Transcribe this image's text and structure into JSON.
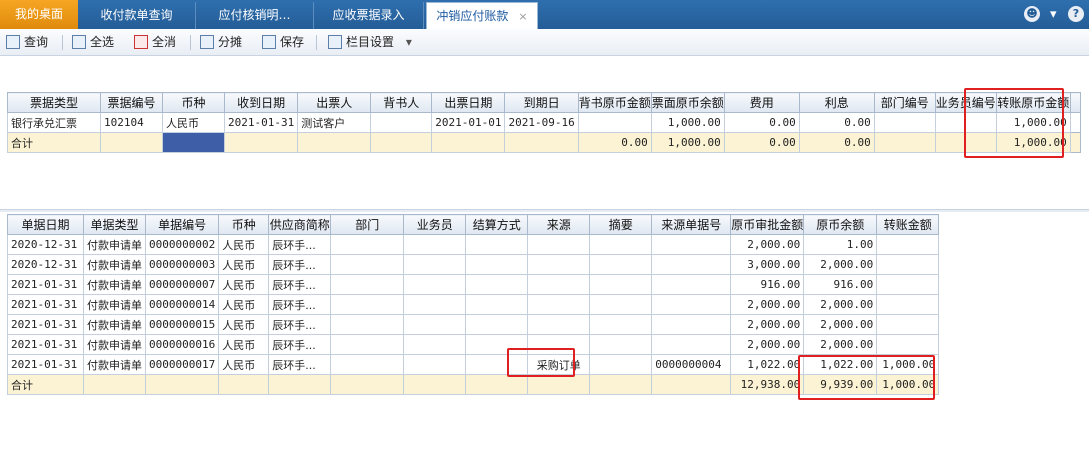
{
  "tabs": [
    {
      "label": "我的桌面"
    },
    {
      "label": "收付款单查询"
    },
    {
      "label": "应付核销明…"
    },
    {
      "label": "应收票据录入"
    },
    {
      "label": "冲销应付账款"
    }
  ],
  "tab_close": "×",
  "window_icons": {
    "user": "☻",
    "dropdown": "▾",
    "help": "?"
  },
  "toolbar": {
    "query": "查询",
    "select_all": "全选",
    "deselect_all": "全消",
    "split": "分摊",
    "save": "保存",
    "columns": "栏目设置",
    "columns_arrow": "▾"
  },
  "upper_table": {
    "headers": [
      "票据类型",
      "票据编号",
      "币种",
      "收到日期",
      "出票人",
      "背书人",
      "出票日期",
      "到期日",
      "背书原币金额",
      "票面原币余额",
      "费用",
      "利息",
      "部门编号",
      "业务员编号",
      "转账原币金额"
    ],
    "rows": [
      [
        "银行承兑汇票",
        "102104",
        "人民币",
        "2021-01-31",
        "测试客户",
        "",
        "2021-01-01",
        "2021-09-16",
        "",
        "1,000.00",
        "0.00",
        "0.00",
        "",
        "",
        "1,000.00"
      ]
    ],
    "total": [
      "合计",
      "",
      "",
      "",
      "",
      "",
      "",
      "",
      "0.00",
      "1,000.00",
      "0.00",
      "0.00",
      "",
      "",
      "1,000.00"
    ]
  },
  "lower_table": {
    "headers": [
      "单据日期",
      "单据类型",
      "单据编号",
      "币种",
      "供应商简称",
      "部门",
      "业务员",
      "结算方式",
      "来源",
      "摘要",
      "来源单据号",
      "原币审批金额",
      "原币余额",
      "转账金额"
    ],
    "rows": [
      [
        "2020-12-31",
        "付款申请单",
        "0000000002",
        "人民币",
        "辰环手...",
        "",
        "",
        "",
        "",
        "",
        "",
        "2,000.00",
        "1.00",
        ""
      ],
      [
        "2020-12-31",
        "付款申请单",
        "0000000003",
        "人民币",
        "辰环手...",
        "",
        "",
        "",
        "",
        "",
        "",
        "3,000.00",
        "2,000.00",
        ""
      ],
      [
        "2021-01-31",
        "付款申请单",
        "0000000007",
        "人民币",
        "辰环手...",
        "",
        "",
        "",
        "",
        "",
        "",
        "916.00",
        "916.00",
        ""
      ],
      [
        "2021-01-31",
        "付款申请单",
        "0000000014",
        "人民币",
        "辰环手...",
        "",
        "",
        "",
        "",
        "",
        "",
        "2,000.00",
        "2,000.00",
        ""
      ],
      [
        "2021-01-31",
        "付款申请单",
        "0000000015",
        "人民币",
        "辰环手...",
        "",
        "",
        "",
        "",
        "",
        "",
        "2,000.00",
        "2,000.00",
        ""
      ],
      [
        "2021-01-31",
        "付款申请单",
        "0000000016",
        "人民币",
        "辰环手...",
        "",
        "",
        "",
        "",
        "",
        "",
        "2,000.00",
        "2,000.00",
        ""
      ],
      [
        "2021-01-31",
        "付款申请单",
        "0000000017",
        "人民币",
        "辰环手...",
        "",
        "",
        "",
        "采购订单",
        "",
        "0000000004",
        "1,022.00",
        "1,022.00",
        "1,000.00"
      ]
    ],
    "total": [
      "合计",
      "",
      "",
      "",
      "",
      "",
      "",
      "",
      "",
      "",
      "",
      "12,938.00",
      "9,939.00",
      "1,000.00"
    ]
  },
  "colors": {
    "tab_bar": "#2f6fae",
    "home_tab": "#f5a623",
    "highlight": "#e02020",
    "total_row": "#fbf3d3",
    "selected_cell": "#3f5ea8"
  }
}
